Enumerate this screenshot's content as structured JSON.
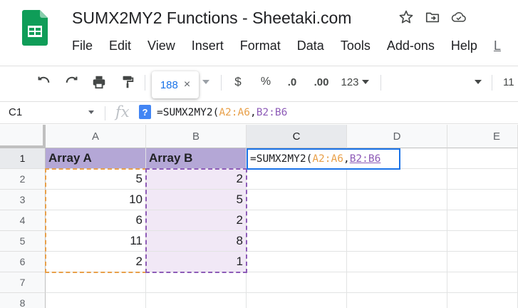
{
  "app": {
    "title": "SUMX2MY2 Functions - Sheetaki.com",
    "menu": [
      "File",
      "Edit",
      "View",
      "Insert",
      "Format",
      "Data",
      "Tools",
      "Add-ons",
      "Help",
      "L"
    ]
  },
  "toolbar": {
    "tooltip_value": "188",
    "tooltip_close": "×",
    "currency": "$",
    "percent": "%",
    "decrease_decimal": ".0",
    "increase_decimal": ".00",
    "more_formats": "123",
    "font_size_partial": "11"
  },
  "formula_bar": {
    "cell_ref": "C1",
    "fx": "fx",
    "help_badge": "?",
    "formula_prefix": "=SUMX2MY2(",
    "range_a": "A2:A6",
    "comma": ",",
    "range_b": "B2:B6"
  },
  "columns": [
    "A",
    "B",
    "C",
    "D",
    "E"
  ],
  "rows": [
    "1",
    "2",
    "3",
    "4",
    "5",
    "6",
    "7",
    "8"
  ],
  "sheet": {
    "headers": [
      "Array A",
      "Array B"
    ],
    "array_a": [
      "5",
      "10",
      "6",
      "11",
      "2"
    ],
    "array_b": [
      "2",
      "5",
      "2",
      "8",
      "1"
    ]
  },
  "editor": {
    "prefix": "=SUMX2MY2(",
    "range_a": "A2:A6",
    "comma": ",",
    "range_b": "B2:B6"
  },
  "colors": {
    "header_fill": "#b4a7d6",
    "array_b_fill": "#f1e8f6",
    "range_a_color": "#e8a04a",
    "range_b_color": "#8e5cb8",
    "active_border": "#1a73e8"
  }
}
